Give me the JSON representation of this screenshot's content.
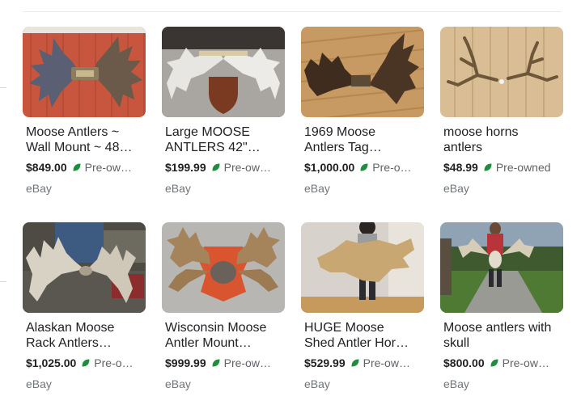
{
  "colors": {
    "leaf": "#1e8e3e",
    "muted": "#5f6368",
    "source": "#70757a"
  },
  "products": [
    {
      "title_line1": "Moose Antlers ~",
      "title_line2": "Wall Mount ~ 48…",
      "price": "$849.00",
      "condition": "Pre-ow…",
      "source": "eBay"
    },
    {
      "title_line1": "Large MOOSE",
      "title_line2": "ANTLERS 42\"…",
      "price": "$199.99",
      "condition": "Pre-ow…",
      "source": "eBay"
    },
    {
      "title_line1": "1969 Moose",
      "title_line2": "Antlers Tag…",
      "price": "$1,000.00",
      "condition": "Pre-o…",
      "source": "eBay"
    },
    {
      "title_line1": "moose horns",
      "title_line2": "antlers",
      "price": "$48.99",
      "condition": "Pre-owned",
      "source": "eBay"
    },
    {
      "title_line1": "Alaskan Moose",
      "title_line2": "Rack Antlers…",
      "price": "$1,025.00",
      "condition": "Pre-o…",
      "source": "eBay"
    },
    {
      "title_line1": "Wisconsin Moose",
      "title_line2": "Antler Mount…",
      "price": "$999.99",
      "condition": "Pre-ow…",
      "source": "eBay"
    },
    {
      "title_line1": "HUGE Moose",
      "title_line2": "Shed Antler Hor…",
      "price": "$529.99",
      "condition": "Pre-ow…",
      "source": "eBay"
    },
    {
      "title_line1": "Moose antlers with",
      "title_line2": "skull",
      "price": "$800.00",
      "condition": "Pre-ow…",
      "source": "eBay"
    }
  ]
}
